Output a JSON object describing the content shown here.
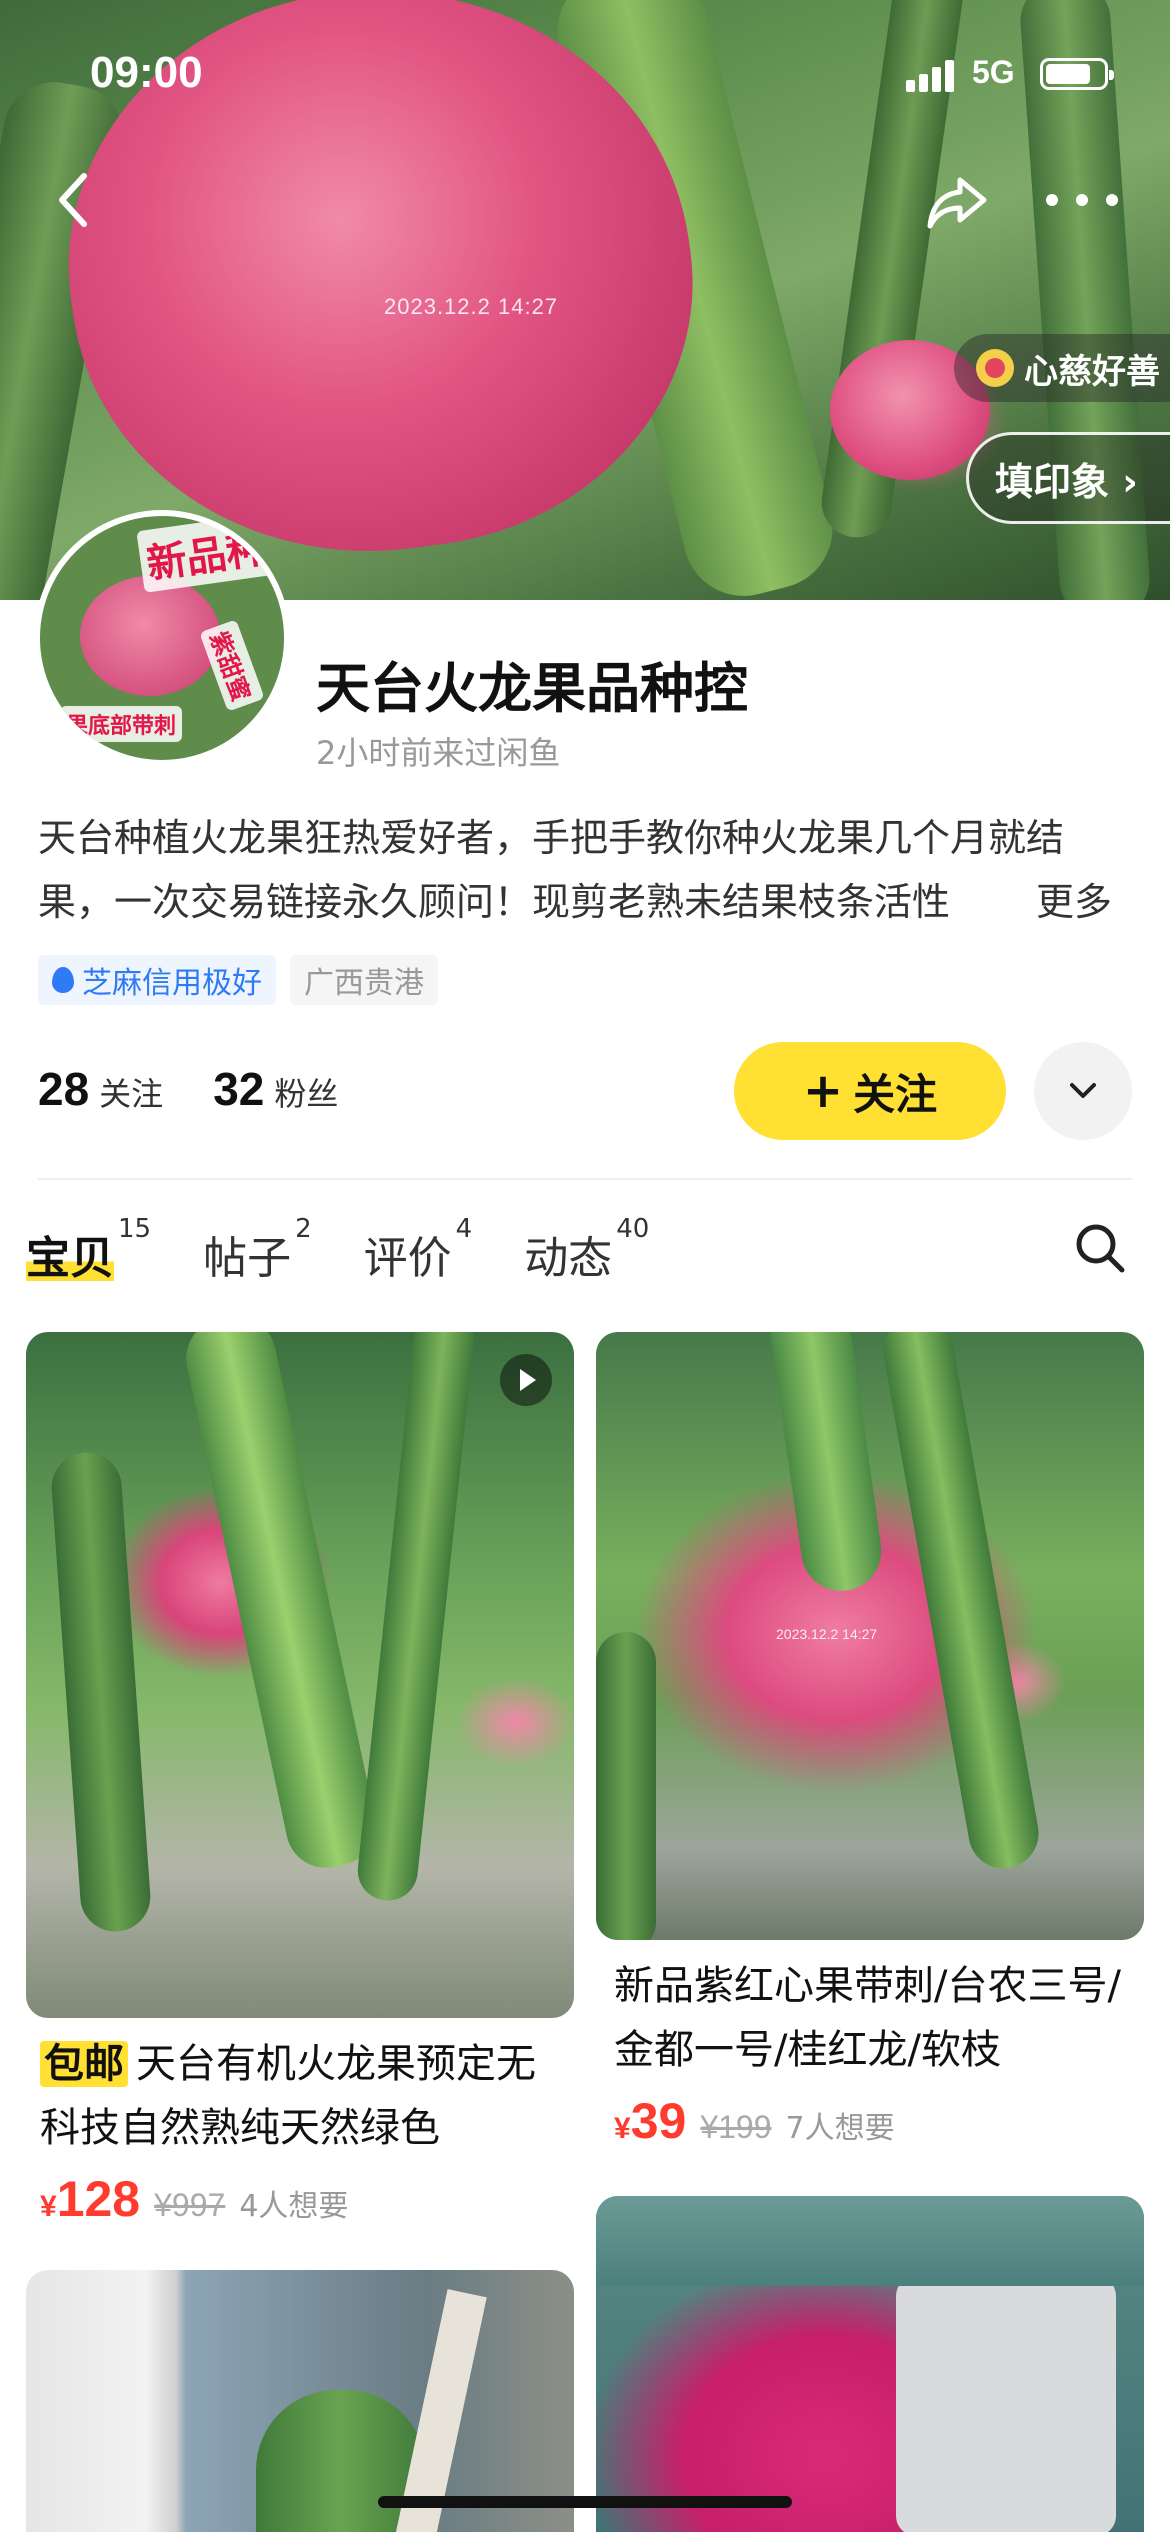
{
  "status_bar": {
    "time": "09:00",
    "network": "5G"
  },
  "hero": {
    "photo_timestamp": "2023.12.2 14:27"
  },
  "nav": {
    "back_icon": "chevron-left-icon",
    "share_icon": "share-icon",
    "more_icon": "more-dots-icon"
  },
  "badges": {
    "kindness": "心慈好善",
    "stamp": "填印象 ›"
  },
  "profile": {
    "name": "天台火龙果品种控",
    "last_visit": "2小时前来过闲鱼",
    "avatar_labels": [
      "新品种",
      "紫甜蜜",
      "果底部带刺"
    ],
    "bio": "天台种植火龙果狂热爱好者，手把手教你种火龙果几个月就结果，一次交易链接永久顾问！现剪老熟未结果枝条活性",
    "bio_more": "更多",
    "credit_tag": "芝麻信用极好",
    "location_tag": "广西贵港",
    "following_count": "28",
    "following_label": "关注",
    "followers_count": "32",
    "followers_label": "粉丝",
    "follow_button": "关注",
    "follow_plus": "+"
  },
  "tabs": [
    {
      "label": "宝贝",
      "count": "15",
      "active": true
    },
    {
      "label": "帖子",
      "count": "2",
      "active": false
    },
    {
      "label": "评价",
      "count": "4",
      "active": false
    },
    {
      "label": "动态",
      "count": "40",
      "active": false
    }
  ],
  "products": [
    {
      "badge": "包邮",
      "title": "天台有机火龙果预定无科技自然熟纯天然绿色",
      "currency": "¥",
      "price": "128",
      "original_price": "¥997",
      "wants": "4人想要",
      "image_stamp": "",
      "has_video": true
    },
    {
      "badge": "",
      "title": "新品紫红心果带刺/台农三号/金都一号/桂红龙/软枝",
      "currency": "¥",
      "price": "39",
      "original_price": "¥199",
      "wants": "7人想要",
      "image_stamp": "2023.12.2 14:27",
      "has_video": false
    }
  ],
  "colors": {
    "accent_yellow": "#ffe033",
    "price_red": "#ff3b30",
    "credit_blue": "#2f7bf5"
  }
}
